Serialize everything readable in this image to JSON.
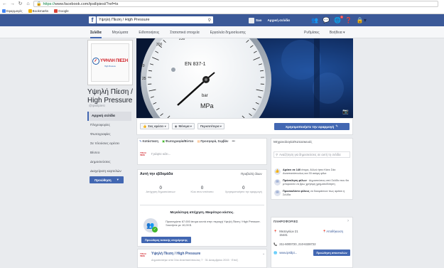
{
  "browser": {
    "url_scheme": "https://",
    "url_rest": "www.facebook.com/ipsilipiesi/?ref=ts",
    "bookmarks": [
      "Εφαρμογές",
      "Bookmarks",
      "Google"
    ]
  },
  "fb_header": {
    "search_value": "Υψηλή Πίεση / High Pressure",
    "user_name": "Sao",
    "home_label": "Αρχική σελίδα",
    "notif_badge": "1"
  },
  "page_nav": {
    "tabs": [
      "Σελίδα",
      "Μηνύματα",
      "Ειδοποιήσεις",
      "Στατιστικά στοιχεία",
      "Εργαλεία δημοσίευσης"
    ],
    "settings": "Ρυθμίσεις",
    "help": "Βοήθεια ▾"
  },
  "page": {
    "logo_text": "ΥΨΗΛΗ ΠΙΕΣΗ",
    "logo_sub": "High Pressure",
    "name": "Υψηλή Πίεση / High Pressure",
    "handle": "@ipsilipiesi"
  },
  "side_menu": [
    "Αρχική σελίδα",
    "Πληροφορίες",
    "Φωτογραφίες",
    "Σε πλούσιες αρέσει",
    "Βίντεο",
    "Δημοσιεύσεις",
    "Διαχείριση καρτελών"
  ],
  "promote_left": "Προώθηση",
  "action_bar": {
    "like": "Σας αρέσει ▾",
    "follow": "Μόνιμα ▾",
    "more": "Περισσότερα ▾",
    "promote": "Χρησιμοποιήστε την εφαρμογή"
  },
  "composer": {
    "tabs": [
      "Κατάσταση",
      "Φωτογραφία/Βίντεο",
      "Προσφορά, Συμβάν",
      "•••"
    ],
    "placeholder": "Γράψτε κάτι..."
  },
  "this_week": {
    "title": "Αυτή την εβδομάδα",
    "see_all": "Προβολή όλων",
    "stats": [
      {
        "num": "0",
        "label": "Απήχηση δημοσιεύσεων"
      },
      {
        "num": "0",
        "label": "Κλικ στον ιστότοπο"
      },
      {
        "num": "0",
        "label": "Χρησιμοποιήστε την εφαρμογή"
      }
    ],
    "reach_title": "Μεγαλύτερη απήχηση. Μικρότερο κόστος.",
    "reach_text": "Προσεγγίστε 67.000 άτομα κοντά στην περιοχή Υψηλή Πίεση / High Pressure. Ξεκινήστε με 10,00 $.",
    "reach_button": "Προώθηση τοπικής επιχείρησης"
  },
  "post": {
    "name": "Υψηλή Πίεση / High Pressure",
    "meta": "Δημοσιεύτηκε από Σάο Αναστασόπουλος 7 · 31 Δεκεμβρίου 2015 · Επεξ."
  },
  "right": {
    "category": "Μηχανολογία/Κατασκευές",
    "search_placeholder": "Αναζήτηση για δημοσιεύσεις σε αυτή τη σελίδα",
    "items": [
      {
        "icon": "like-icon",
        "bold": "Αρέσει σε 140",
        "text": " άτομα, Αλλού ήταν Κάνε Σάο Αναστασόπουλος και 33 ακόμη φίλοι"
      },
      {
        "icon": "invite-icon",
        "bold": "Πρόσκληση φίλων",
        "text": " · Δημοσιεύσεις από Σελίδα που θα μπορούσα να βρω χρήσιμη χρηματοδότηση"
      },
      {
        "icon": "mail-icon",
        "bold": "Προσκαλέστε φίλους",
        "text": " να δοκιμάσουν πως αρέσει η Σελίδα"
      }
    ],
    "info_title": "ΠΛΗΡΟΦΟΡΙΕΣ",
    "address": "Μεσογείων 21\n15441",
    "map_link": "Αποθήκευση",
    "phone": "211-6000720, 210-6328722",
    "website": "www.ipsilipi...",
    "send_button": "Προώθηση αποστολών"
  }
}
